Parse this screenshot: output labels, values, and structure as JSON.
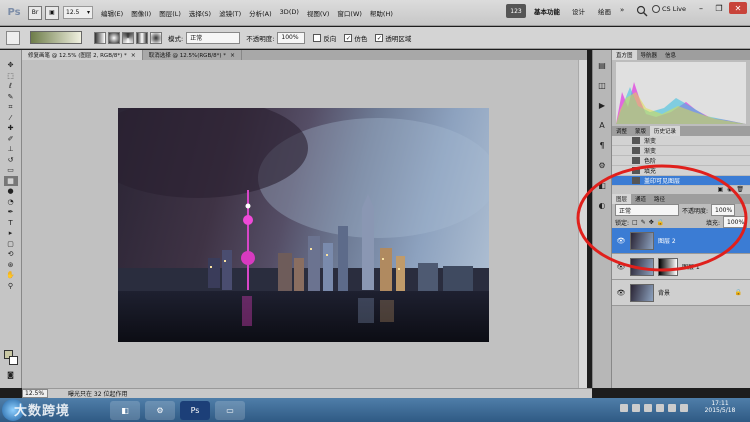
{
  "app": {
    "logo": "Ps",
    "zoom_field": "12.5"
  },
  "menu": [
    "编辑(E)",
    "图像(I)",
    "图层(L)",
    "选择(S)",
    "滤镜(T)",
    "分析(A)",
    "3D(D)",
    "视图(V)",
    "窗口(W)",
    "帮助(H)"
  ],
  "workspace": {
    "badge": "123",
    "items": [
      "基本功能",
      "设计",
      "绘画"
    ],
    "more": "»",
    "cslive": "CS Live"
  },
  "options": {
    "mode_label": "模式:",
    "mode_value": "正常",
    "opacity_label": "不透明度:",
    "opacity_value": "100%",
    "reverse": "反向",
    "dither": "仿色",
    "transparency": "透明区域"
  },
  "tabs": [
    {
      "label": "修复画笔 @ 12.5% (图层 2, RGB/8*) *",
      "close": "×"
    },
    {
      "label": "取消选择 @ 12.5%(RGB/8*) *",
      "close": "×"
    }
  ],
  "panels": {
    "top_tabs": [
      "直方图",
      "导航器",
      "信息"
    ],
    "history_tabs": [
      "调整",
      "蒙版",
      "历史记录"
    ],
    "history_items": [
      "渐变",
      "渐变",
      "色阶",
      "填充",
      "盖印可见图层"
    ],
    "layer_tabs": [
      "图层",
      "通道",
      "路径"
    ],
    "blend_mode": "正常",
    "opacity_label": "不透明度:",
    "opacity_value": "100%",
    "lock_label": "锁定:",
    "fill_label": "填充:",
    "fill_value": "100%",
    "layers": [
      "图层 2",
      "图层 1",
      "背景"
    ]
  },
  "status": {
    "zoom": "12.5%",
    "info": "曝光只在 32 位起作用"
  },
  "watermark": "大数跨境",
  "taskbar": {
    "ps_label": "Ps",
    "time": "17:11",
    "date": "2015/5/18"
  },
  "colors": {
    "selection": "#3b7cd4",
    "annotation": "#e0201c"
  }
}
